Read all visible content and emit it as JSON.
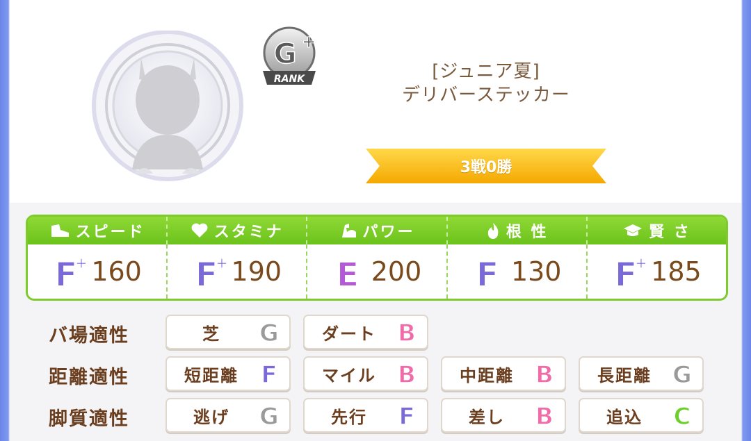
{
  "rank": {
    "letter": "G",
    "modifier": "+",
    "caption": "RANK"
  },
  "character": {
    "title": "[ジュニア夏]",
    "name": "デリバーステッカー"
  },
  "record": "3戦0勝",
  "colors": {
    "stat_green": "#7dcc2c",
    "text_brown": "#6a3e1e",
    "ribbon_yellow": "#f7b90b",
    "grade_F": "#7a6ad8",
    "grade_E": "#b45ad6",
    "grade_B": "#f06ba8",
    "grade_G": "#9a9a9a",
    "grade_C": "#6ccf2c"
  },
  "stats": [
    {
      "label": "スピード",
      "icon": "shoe-icon",
      "grade": "F",
      "plus": "+",
      "value": "160"
    },
    {
      "label": "スタミナ",
      "icon": "heart-icon",
      "grade": "F",
      "plus": "+",
      "value": "190"
    },
    {
      "label": "パワー",
      "icon": "muscle-icon",
      "grade": "E",
      "plus": "",
      "value": "200"
    },
    {
      "label": "根 性",
      "icon": "flame-icon",
      "grade": "F",
      "plus": "",
      "value": "130"
    },
    {
      "label": "賢 さ",
      "icon": "graduation-cap-icon",
      "grade": "F",
      "plus": "+",
      "value": "185"
    }
  ],
  "aptitudes": {
    "ground": {
      "label": "バ場適性",
      "items": [
        {
          "label": "芝",
          "grade": "G"
        },
        {
          "label": "ダート",
          "grade": "B"
        }
      ]
    },
    "distance": {
      "label": "距離適性",
      "items": [
        {
          "label": "短距離",
          "grade": "F"
        },
        {
          "label": "マイル",
          "grade": "B"
        },
        {
          "label": "中距離",
          "grade": "B"
        },
        {
          "label": "長距離",
          "grade": "G"
        }
      ]
    },
    "style": {
      "label": "脚質適性",
      "items": [
        {
          "label": "逃げ",
          "grade": "G"
        },
        {
          "label": "先行",
          "grade": "F"
        },
        {
          "label": "差し",
          "grade": "B"
        },
        {
          "label": "追込",
          "grade": "C"
        }
      ]
    }
  }
}
